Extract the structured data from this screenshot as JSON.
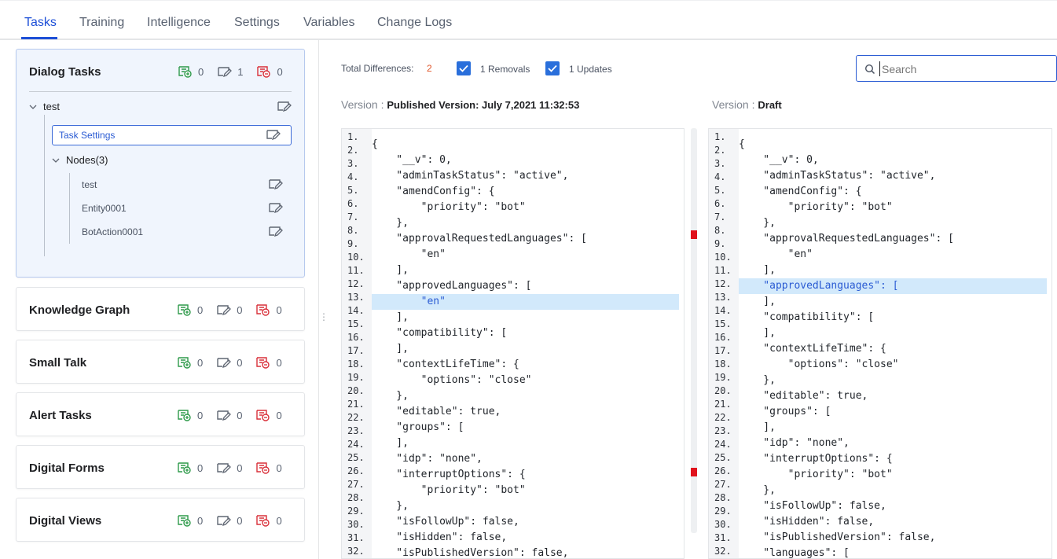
{
  "tabs": [
    "Tasks",
    "Training",
    "Intelligence",
    "Settings",
    "Variables",
    "Change Logs"
  ],
  "colors": {
    "accent": "#1d4fd7",
    "add_green": "#2e9a4a",
    "update_gray": "#5f6672",
    "remove_red": "#d9303a",
    "highlight": "#d2e9fb",
    "diff_marker": "#e0121c"
  },
  "sidebar": {
    "dialog_tasks": {
      "title": "Dialog Tasks",
      "counts": [
        "0",
        "1",
        "0"
      ],
      "tree": {
        "task": "test",
        "task_settings": "Task Settings",
        "nodes_label": "Nodes(3)",
        "nodes": [
          "test",
          "Entity0001",
          "BotAction0001"
        ]
      }
    },
    "cards": [
      {
        "title": "Knowledge Graph",
        "counts": [
          "0",
          "0",
          "0"
        ]
      },
      {
        "title": "Small Talk",
        "counts": [
          "0",
          "0",
          "0"
        ]
      },
      {
        "title": "Alert Tasks",
        "counts": [
          "0",
          "0",
          "0"
        ]
      },
      {
        "title": "Digital Forms",
        "counts": [
          "0",
          "0",
          "0"
        ]
      },
      {
        "title": "Digital Views",
        "counts": [
          "0",
          "0",
          "0"
        ]
      }
    ]
  },
  "summary": {
    "total_label": "Total Differences:",
    "total_value": "2",
    "removals_label": "1 Removals",
    "updates_label": "1 Updates",
    "search_placeholder": "Search"
  },
  "versions": {
    "label": "Version :",
    "left": "Published Version: July 7,2021 11:32:53",
    "right": "Draft"
  },
  "left_code": [
    "{",
    "    \"__v\": 0,",
    "    \"adminTaskStatus\": \"active\",",
    "    \"amendConfig\": {",
    "        \"priority\": \"bot\"",
    "    },",
    "    \"approvalRequestedLanguages\": [",
    "        \"en\"",
    "    ],",
    "    \"approvedLanguages\": [",
    "        \"en\"",
    "    ],",
    "    \"compatibility\": [",
    "    ],",
    "    \"contextLifeTime\": {",
    "        \"options\": \"close\"",
    "    },",
    "    \"editable\": true,",
    "    \"groups\": [",
    "    ],",
    "    \"idp\": \"none\",",
    "    \"interruptOptions\": {",
    "        \"priority\": \"bot\"",
    "    },",
    "    \"isFollowUp\": false,",
    "    \"isHidden\": false,",
    "    \"isPublishedVersion\": false,"
  ],
  "right_code": [
    "{",
    "    \"__v\": 0,",
    "    \"adminTaskStatus\": \"active\",",
    "    \"amendConfig\": {",
    "        \"priority\": \"bot\"",
    "    },",
    "    \"approvalRequestedLanguages\": [",
    "        \"en\"",
    "    ],",
    "    \"approvedLanguages\": [",
    "    ],",
    "    \"compatibility\": [",
    "    ],",
    "    \"contextLifeTime\": {",
    "        \"options\": \"close\"",
    "    },",
    "    \"editable\": true,",
    "    \"groups\": [",
    "    ],",
    "    \"idp\": \"none\",",
    "    \"interruptOptions\": {",
    "        \"priority\": \"bot\"",
    "    },",
    "    \"isFollowUp\": false,",
    "    \"isHidden\": false,",
    "    \"isPublishedVersion\": false,",
    "    \"languages\": ["
  ],
  "line_numbers": [
    "1.",
    "2.",
    "3.",
    "4.",
    "5.",
    "6.",
    "7.",
    "8.",
    "9.",
    "10.",
    "11.",
    "12.",
    "13.",
    "14.",
    "15.",
    "16.",
    "17.",
    "18.",
    "19.",
    "20.",
    "21.",
    "22.",
    "23.",
    "24.",
    "25.",
    "26.",
    "27.",
    "28.",
    "29.",
    "30.",
    "31.",
    "32."
  ]
}
